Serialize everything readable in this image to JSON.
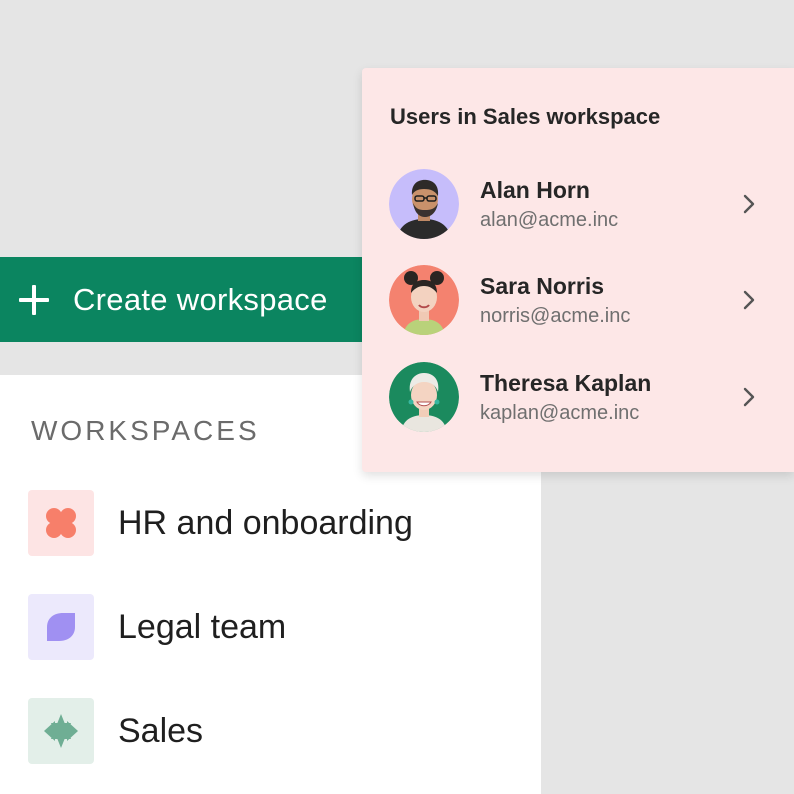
{
  "create_button": {
    "label": "Create workspace",
    "icon": "plus-icon"
  },
  "workspaces": {
    "heading": "WORKSPACES",
    "items": [
      {
        "name": "HR and onboarding",
        "icon": "clover-icon",
        "color": "#f77f6a",
        "tile_color": "#fde4e4"
      },
      {
        "name": "Legal team",
        "icon": "leaf-icon",
        "color": "#a090f2",
        "tile_color": "#ece9fc"
      },
      {
        "name": "Sales",
        "icon": "star-icon",
        "color": "#6fae94",
        "tile_color": "#e3efe9"
      }
    ]
  },
  "users_popup": {
    "title": "Users in Sales workspace",
    "users": [
      {
        "name": "Alan Horn",
        "email": "alan@acme.inc",
        "avatar_bg": "#c6bdfb"
      },
      {
        "name": "Sara Norris",
        "email": "norris@acme.inc",
        "avatar_bg": "#f4826f"
      },
      {
        "name": "Theresa Kaplan",
        "email": "kaplan@acme.inc",
        "avatar_bg": "#1b8a5e"
      }
    ],
    "chevron_icon": "chevron-right-icon"
  },
  "colors": {
    "accent": "#0b8560",
    "popup_bg": "#fde7e7",
    "page_bg": "#e5e5e5"
  }
}
